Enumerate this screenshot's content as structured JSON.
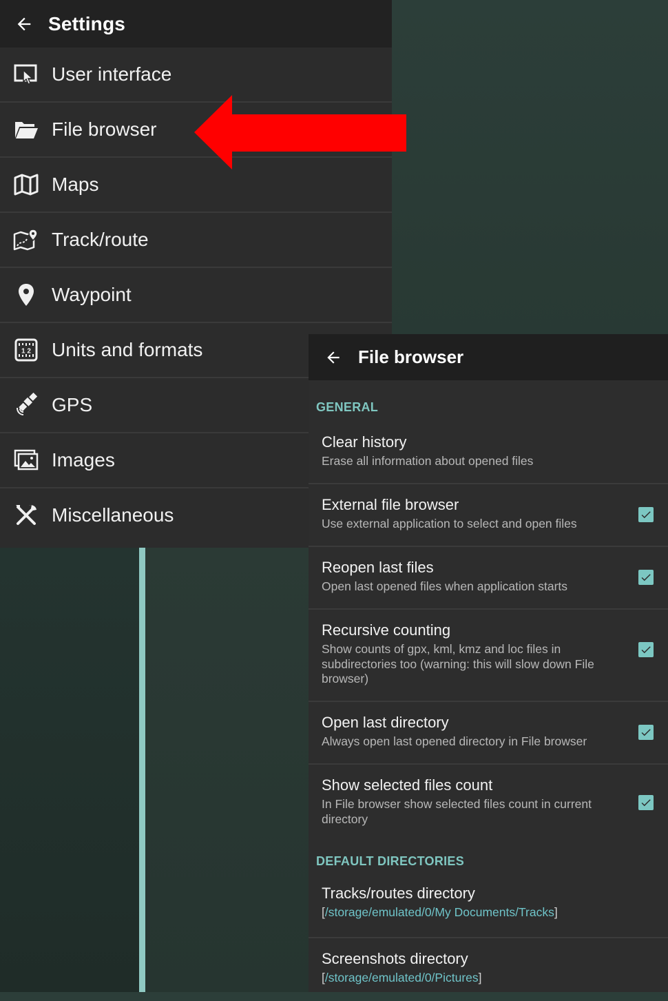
{
  "settings": {
    "title": "Settings",
    "items": [
      {
        "label": "User interface",
        "icon": "user-interface-icon"
      },
      {
        "label": "File browser",
        "icon": "folder-open-icon"
      },
      {
        "label": "Maps",
        "icon": "map-icon"
      },
      {
        "label": "Track/route",
        "icon": "track-route-icon"
      },
      {
        "label": "Waypoint",
        "icon": "location-pin-icon"
      },
      {
        "label": "Units and formats",
        "icon": "units-icon"
      },
      {
        "label": "GPS",
        "icon": "satellite-icon"
      },
      {
        "label": "Images",
        "icon": "images-icon"
      },
      {
        "label": "Miscellaneous",
        "icon": "tools-icon"
      }
    ]
  },
  "file_browser": {
    "title": "File browser",
    "sections": {
      "general": "GENERAL",
      "default_dirs": "DEFAULT DIRECTORIES"
    },
    "prefs": [
      {
        "title": "Clear history",
        "summary": "Erase all information about opened files"
      },
      {
        "title": "External file browser",
        "summary": "Use external application to select and open files",
        "checked": true
      },
      {
        "title": "Reopen last files",
        "summary": "Open last opened files when application starts",
        "checked": true
      },
      {
        "title": "Recursive counting",
        "summary": "Show counts of gpx, kml, kmz and loc files in subdirectories too (warning: this will slow down File browser)",
        "checked": true
      },
      {
        "title": "Open last directory",
        "summary": "Always open last opened directory in File browser",
        "checked": true
      },
      {
        "title": "Show selected files count",
        "summary": "In File browser show selected files count in current directory",
        "checked": true
      }
    ],
    "directories": [
      {
        "title": "Tracks/routes directory",
        "path": "/storage/emulated/0/My Documents/Tracks"
      },
      {
        "title": "Screenshots directory",
        "path": "/storage/emulated/0/Pictures"
      }
    ]
  },
  "colors": {
    "accent": "#7fc6c0",
    "highlight_arrow": "#ff0000"
  }
}
